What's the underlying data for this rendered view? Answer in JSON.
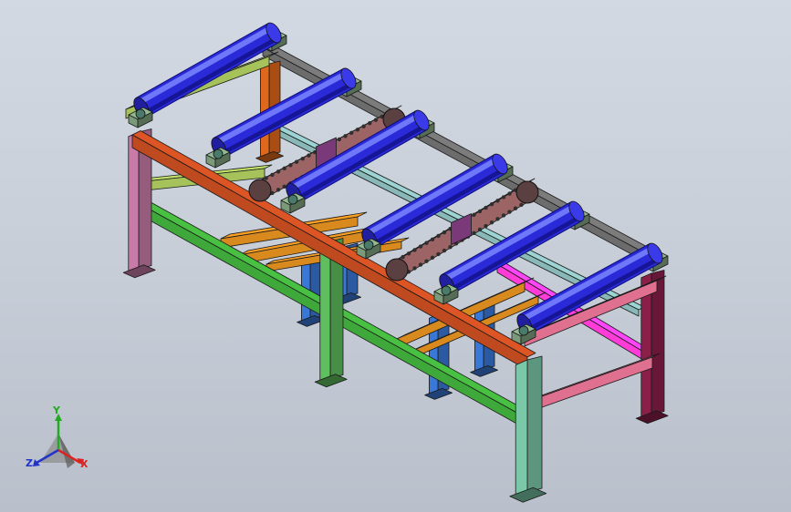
{
  "viewport": {
    "background_top": "#d3d9e2",
    "background_bottom": "#b9c0cb"
  },
  "colors": {
    "roller": "#2a2ad8",
    "roller_shadow": "#0d0d7a",
    "roller_highlight": "#7a86ff",
    "top_rail_front": "#c04a1f",
    "top_rail_back": "#6c6c6c",
    "left_crossbar": "#a6c25a",
    "right_crossbar": "#e07090",
    "lower_rail_front": "#3fa83a",
    "lower_rail_back": "#1f5e1f",
    "inner_beam_orange": "#d98a1e",
    "inner_beam_teal": "#88b8b8",
    "magenta_brace": "#ff3cd8",
    "post_pink": "#c87aa8",
    "post_green": "#5fbf5f",
    "post_light": "#7ac8a8",
    "post_orange": "#e0681c",
    "post_blue": "#3a78d8",
    "post_maroon": "#8a1f4a",
    "chain_body": "#9c6464",
    "chain_dark": "#2f2f2f",
    "bearing_block": "#7a9a7a"
  },
  "triad": {
    "x_label": "X",
    "y_label": "Y",
    "z_label": "Z"
  }
}
